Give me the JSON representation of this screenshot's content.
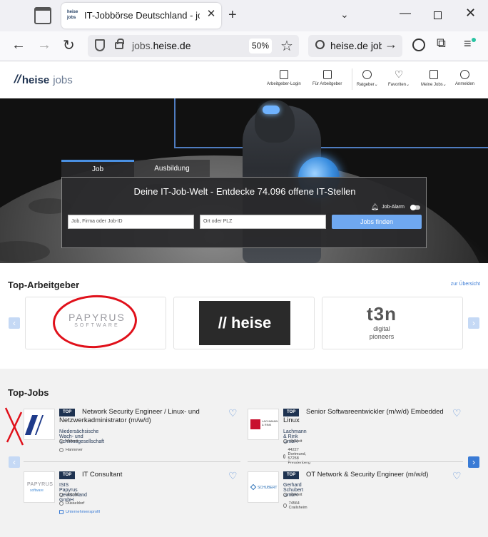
{
  "browser": {
    "tab_title": "IT-Jobbörse Deutschland - jobs.heise.de",
    "favicon_text": "heise jobs",
    "url_domain_prefix": "jobs.",
    "url_domain_main": "heise.de",
    "zoom": "50%",
    "search_text": "heise.de jobs"
  },
  "site": {
    "logo_heise": "heise",
    "logo_jobs": "jobs",
    "nav": [
      {
        "label": "Arbeitgeber-Login"
      },
      {
        "label": "Für Arbeitgeber"
      },
      {
        "label": "Ratgeber⌄"
      },
      {
        "label": "Favoriten⌄"
      },
      {
        "label": "Meine Jobs⌄"
      },
      {
        "label": "Anmelden"
      }
    ]
  },
  "hero": {
    "tabs": {
      "job": "Job",
      "ausbildung": "Ausbildung"
    },
    "title": "Deine IT-Job-Welt - Entdecke 74.096 offene IT-Stellen",
    "alarm_label": "Job-Alarm",
    "job_placeholder": "Job, Firma oder Job-ID",
    "ort_placeholder": "Ort oder PLZ",
    "button": "Jobs finden"
  },
  "employers": {
    "title": "Top-Arbeitgeber",
    "link": "zur Übersicht",
    "logos": {
      "papyrus_main": "PAPYRUS",
      "papyrus_sub": "SOFTWARE",
      "heise": "heise",
      "t3n_big": "t3n",
      "t3n_small1": "digital",
      "t3n_small2": "pioneers"
    }
  },
  "jobs": {
    "title": "Top-Jobs",
    "badge": "TOP",
    "items": [
      {
        "title": "Network Security Engineer / Linux- und Netzwerkadministrator (m/w/d)",
        "company": "Niedersächsische Wach- und Schliessgesellschaft",
        "type": "Vollzeit",
        "location": "Hannover",
        "logo": "WSG"
      },
      {
        "title": "Senior Softwareentwickler (m/w/d) Embedded Linux",
        "company": "Lachmann & Rink GmbH",
        "type": "Vollzeit",
        "location": "44227 Dortmund, 57258 Freudenberg",
        "logo": "LACHMANN & RINK"
      },
      {
        "title": "IT Consultant",
        "company": "ISIS Papyrus Deutschland GmbH",
        "type": "Vollzeit",
        "location": "Düsseldorf",
        "extra": "Unternehmensprofil",
        "logo": "PAPYRUS software"
      },
      {
        "title": "OT Network & Security Engineer (m/w/d)",
        "company": "Gerhard Schubert GmbH",
        "type": "Vollzeit",
        "location": "74564 Crailsheim",
        "logo": "SCHUBERT"
      }
    ]
  },
  "colors": {
    "accent": "#4a90e2",
    "navy": "#1e3250",
    "annotation_red": "#e0101a"
  }
}
